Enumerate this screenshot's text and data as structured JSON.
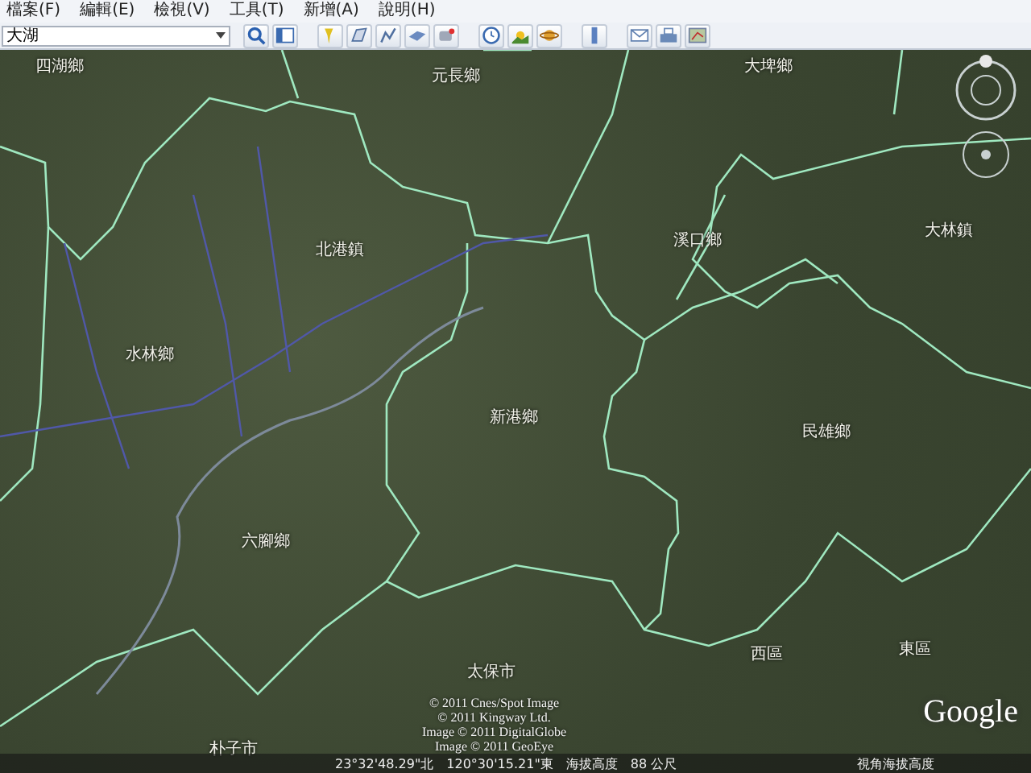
{
  "menu": [
    {
      "label": "檔案(F)"
    },
    {
      "label": "編輯(E)"
    },
    {
      "label": "檢視(V)"
    },
    {
      "label": "工具(T)"
    },
    {
      "label": "新增(A)"
    },
    {
      "label": "說明(H)"
    }
  ],
  "search": {
    "value": "大湖"
  },
  "map": {
    "labels": [
      "四湖鄉",
      "元長鄉",
      "大埤鄉",
      "北港鎮",
      "溪口鄉",
      "大林鎮",
      "水林鄉",
      "新港鄉",
      "民雄鄉",
      "六腳鄉",
      "太保市",
      "西區",
      "東區",
      "朴子市"
    ],
    "copyright": [
      "© 2011 Cnes/Spot Image",
      "© 2011 Kingway Ltd.",
      "Image © 2011 DigitalGlobe",
      "Image © 2011 GeoEye"
    ],
    "logo": "Google"
  },
  "status_bar": {
    "latitude": "23°32'48.29\"北",
    "longitude": "120°30'15.21\"東",
    "elevation_label": "海拔高度",
    "elevation": "88 公尺",
    "eye_alt_label": "視角海拔高度"
  }
}
